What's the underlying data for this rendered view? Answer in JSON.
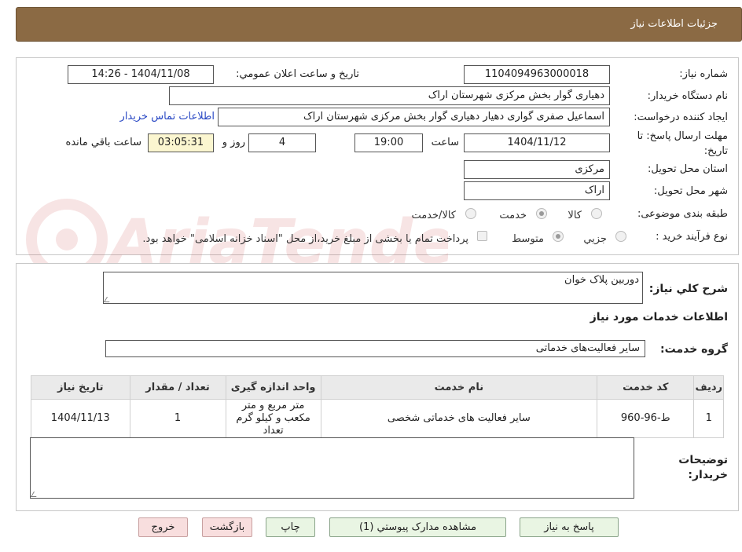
{
  "header": {
    "title": "جزئیات اطلاعات نیاز"
  },
  "fields": {
    "need_number_label": "شماره نیاز:",
    "need_number": "1104094963000018",
    "announce_label": "تاریخ و ساعت اعلان عمومي:",
    "announce_value": "1404/11/08 - 14:26",
    "buyer_org_label": "نام دستگاه خریدار:",
    "buyer_org": "دهیاری گوار بخش مرکزی  شهرستان اراک",
    "requester_label": "ایجاد کننده درخواست:",
    "requester": "اسماعیل صفری گواری دهیار دهیاری گوار بخش مرکزی  شهرستان اراک",
    "contact_link": "اطلاعات تماس خریدار",
    "deadline_label_1": "مهلت ارسال پاسخ: تا",
    "deadline_label_2": "تاریخ:",
    "deadline_date": "1404/11/12",
    "time_label": "ساعت",
    "deadline_time": "19:00",
    "days_value": "4",
    "days_label": "روز و",
    "remaining_time": "03:05:31",
    "remaining_label": "ساعت باقي مانده",
    "province_label": "استان محل تحویل:",
    "province": "مرکزی",
    "city_label": "شهر محل تحویل:",
    "city": "اراک",
    "category_label": "طبقه بندی موضوعی:",
    "category_options": [
      "کالا",
      "خدمت",
      "کالا/خدمت"
    ],
    "purchase_type_label": "نوع فرآیند خرید :",
    "purchase_options": [
      "جزیي",
      "متوسط"
    ],
    "payment_note": "پرداخت تمام یا بخشی از مبلغ خرید،از محل \"اسناد خزانه اسلامی\" خواهد بود."
  },
  "description": {
    "label": "شرح کلي نیاز:",
    "value": "دوربین پلاک خوان"
  },
  "services": {
    "section_title": "اطلاعات خدمات مورد نیاز",
    "group_label": "گروه خدمت:",
    "group_value": "سایر فعالیت‌های خدماتی",
    "columns": [
      "ردیف",
      "کد خدمت",
      "نام خدمت",
      "واحد اندازه گیری",
      "تعداد / مقدار",
      "تاریخ نیاز"
    ],
    "rows": [
      [
        "1",
        "ط-96-960",
        "سایر فعالیت های خدماتی شخصی",
        "متر مربع و متر مکعب و کیلو گرم تعداد",
        "1",
        "1404/11/13"
      ]
    ]
  },
  "buyer_notes": {
    "label_1": "توضیحات",
    "label_2": "خریدار:",
    "value": ""
  },
  "buttons": {
    "reply": "پاسخ به نیاز",
    "attachments": "مشاهده مدارک پیوستي (1)",
    "print": "چاپ",
    "back": "بازگشت",
    "exit": "خروج"
  },
  "watermark": {
    "text": "AriaTender.neT"
  },
  "colors": {
    "header": "#8b6a44",
    "link": "#2a49c4",
    "button_green": "#e9f5e3",
    "button_pink": "#f8dede",
    "timer_bg": "#fbf6d0"
  }
}
